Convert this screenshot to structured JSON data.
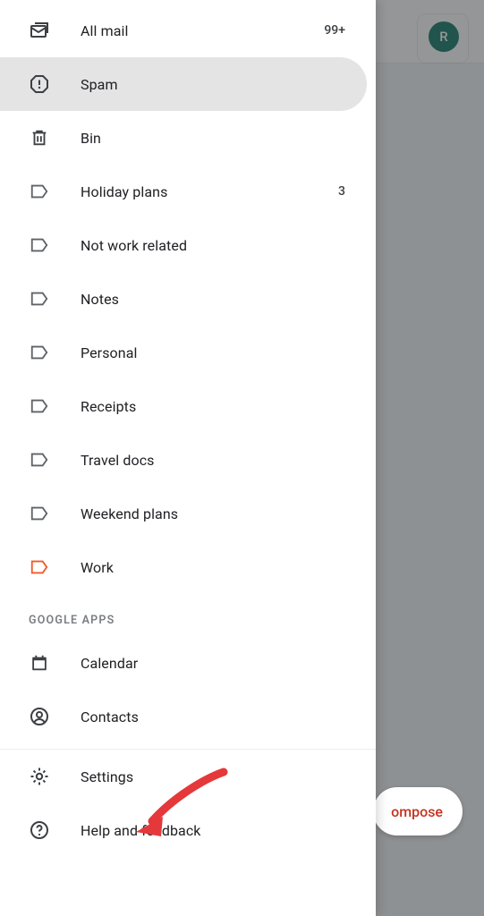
{
  "avatar": {
    "initial": "R"
  },
  "compose": {
    "label": "ompose"
  },
  "drawer": {
    "items": [
      {
        "key": "allmail",
        "label": "All mail",
        "count": "99+",
        "icon": "stacked-mail-icon"
      },
      {
        "key": "spam",
        "label": "Spam",
        "count": "",
        "icon": "spam-icon",
        "selected": true
      },
      {
        "key": "bin",
        "label": "Bin",
        "count": "",
        "icon": "trash-icon"
      },
      {
        "key": "holiday",
        "label": "Holiday plans",
        "count": "3",
        "icon": "label-icon"
      },
      {
        "key": "notwork",
        "label": "Not work related",
        "count": "",
        "icon": "label-icon"
      },
      {
        "key": "notes",
        "label": "Notes",
        "count": "",
        "icon": "label-icon"
      },
      {
        "key": "personal",
        "label": "Personal",
        "count": "",
        "icon": "label-icon"
      },
      {
        "key": "receipts",
        "label": "Receipts",
        "count": "",
        "icon": "label-icon"
      },
      {
        "key": "travel",
        "label": "Travel docs",
        "count": "",
        "icon": "label-icon"
      },
      {
        "key": "weekend",
        "label": "Weekend plans",
        "count": "",
        "icon": "label-icon"
      },
      {
        "key": "work",
        "label": "Work",
        "count": "",
        "icon": "label-icon",
        "accent": "work"
      }
    ],
    "section_header": "GOOGLE APPS",
    "apps": [
      {
        "key": "calendar",
        "label": "Calendar",
        "icon": "calendar-icon"
      },
      {
        "key": "contacts",
        "label": "Contacts",
        "icon": "contacts-icon"
      }
    ],
    "footer": [
      {
        "key": "settings",
        "label": "Settings",
        "icon": "gear-icon"
      },
      {
        "key": "help",
        "label": "Help and feedback",
        "icon": "help-icon"
      }
    ]
  }
}
